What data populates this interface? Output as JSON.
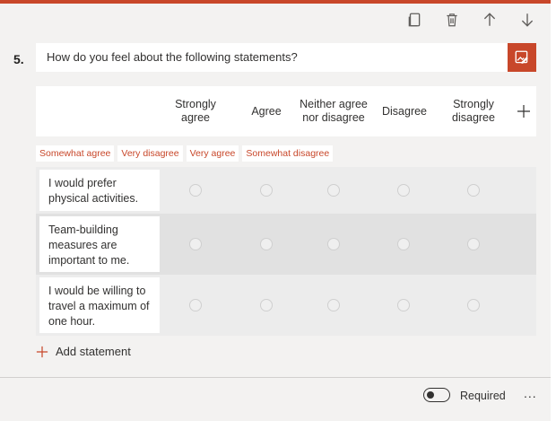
{
  "question": {
    "number": "5.",
    "title": "How do you feel about the following statements?"
  },
  "toolbar": {
    "icons": [
      "copy-icon",
      "delete-icon",
      "arrow-up-icon",
      "arrow-down-icon"
    ]
  },
  "columns": [
    "Strongly agree",
    "Agree",
    "Neither agree nor disagree",
    "Disagree",
    "Strongly disagree"
  ],
  "suggestions": [
    "Somewhat agree",
    "Very disagree",
    "Very agree",
    "Somewhat disagree"
  ],
  "statements": [
    "I would prefer physical activities.",
    "Team-building measures are important to me.",
    "I would be willing to travel a maximum of one hour."
  ],
  "add_statement_label": "Add statement",
  "footer": {
    "required_label": "Required",
    "required_on": false,
    "more_label": "..."
  },
  "colors": {
    "accent": "#c8472a"
  }
}
